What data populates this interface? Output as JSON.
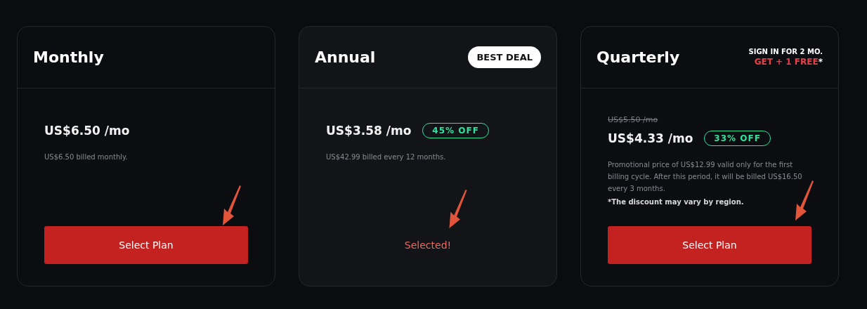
{
  "plans": [
    {
      "name": "Monthly",
      "selected": false,
      "price": "US$6.50 /mo",
      "note": "US$6.50 billed monthly.",
      "action": "Select Plan"
    },
    {
      "name": "Annual",
      "selected": true,
      "header_extra": {
        "kind": "badge",
        "text": "BEST DEAL"
      },
      "price": "US$3.58 /mo",
      "discount": "45% OFF",
      "note": "US$42.99 billed every 12 months.",
      "action": "Selected!"
    },
    {
      "name": "Quarterly",
      "selected": false,
      "header_extra": {
        "kind": "promo",
        "line": "SIGN IN FOR 2 MO.",
        "highlight": "GET + 1 FREE",
        "mark": "*"
      },
      "old_price": "US$5.50 /mo",
      "price": "US$4.33 /mo",
      "discount": "33% OFF",
      "note": "Promotional price of US$12.99 valid only for the first billing cycle. After this period, it will be billed US$16.50 every 3 months.",
      "disclaimer": "*The discount may vary by region.",
      "action": "Select Plan"
    }
  ]
}
